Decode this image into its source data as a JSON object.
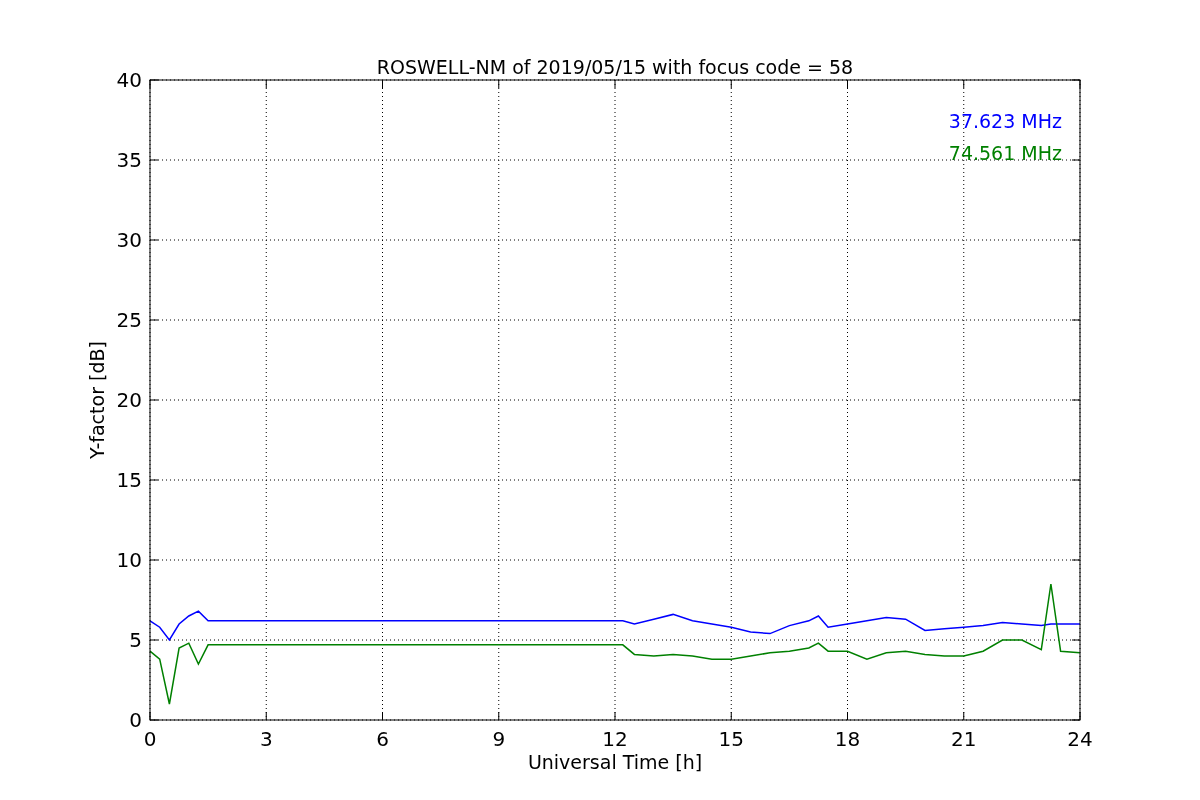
{
  "chart_data": {
    "type": "line",
    "title": "ROSWELL-NM of 2019/05/15 with focus code = 58",
    "xlabel": "Universal Time [h]",
    "ylabel": "Y-factor [dB]",
    "xlim": [
      0,
      24
    ],
    "ylim": [
      0,
      40
    ],
    "xticks": [
      0,
      3,
      6,
      9,
      12,
      15,
      18,
      21,
      24
    ],
    "yticks": [
      0,
      5,
      10,
      15,
      20,
      25,
      30,
      35,
      40
    ],
    "grid": true,
    "x": [
      0,
      0.25,
      0.5,
      0.75,
      1,
      1.25,
      1.5,
      12.2,
      12.5,
      13,
      13.5,
      14,
      14.5,
      15,
      15.5,
      16,
      16.5,
      17,
      17.25,
      17.5,
      18,
      18.5,
      19,
      19.5,
      20,
      20.5,
      21,
      21.5,
      22,
      22.5,
      23,
      23.25,
      23.5,
      24
    ],
    "series": [
      {
        "name": "37.623 MHz",
        "color": "#0000ff",
        "values": [
          6.2,
          5.8,
          5.0,
          6.0,
          6.5,
          6.8,
          6.2,
          6.2,
          6.0,
          6.3,
          6.6,
          6.2,
          6.0,
          5.8,
          5.5,
          5.4,
          5.9,
          6.2,
          6.5,
          5.8,
          6.0,
          6.2,
          6.4,
          6.3,
          5.6,
          5.7,
          5.8,
          5.9,
          6.1,
          6.0,
          5.9,
          6.0,
          6.0,
          6.0
        ]
      },
      {
        "name": "74.561 MHz",
        "color": "#008000",
        "values": [
          4.3,
          3.8,
          1.0,
          4.5,
          4.8,
          3.5,
          4.7,
          4.7,
          4.1,
          4.0,
          4.1,
          4.0,
          3.8,
          3.8,
          4.0,
          4.2,
          4.3,
          4.5,
          4.8,
          4.3,
          4.3,
          3.8,
          4.2,
          4.3,
          4.1,
          4.0,
          4.0,
          4.3,
          5.0,
          5.0,
          4.4,
          8.5,
          4.3,
          4.2
        ]
      }
    ]
  }
}
